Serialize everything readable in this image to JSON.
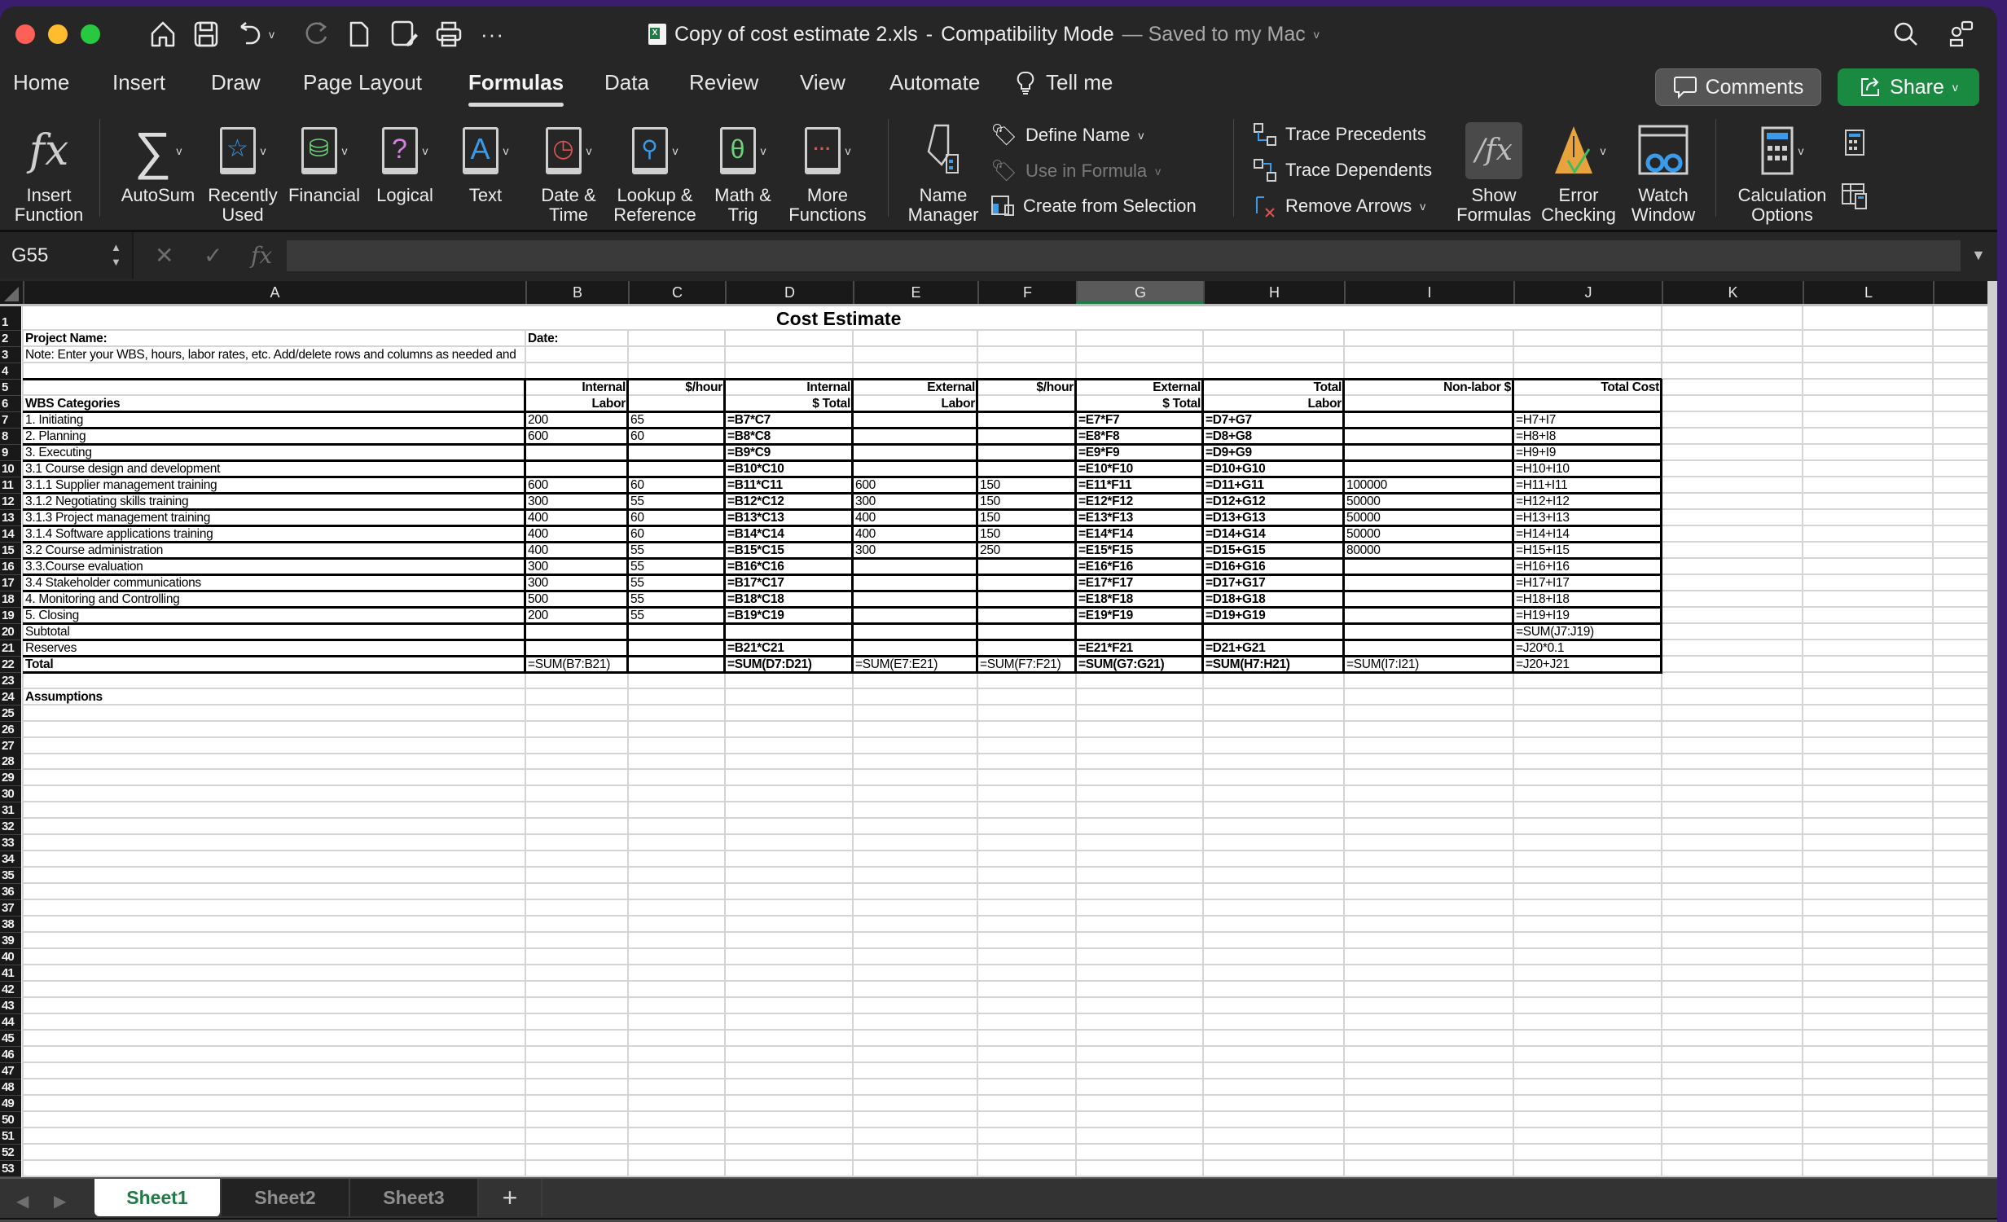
{
  "window": {
    "title": "Copy of cost estimate 2.xls",
    "mode": "Compatibility Mode",
    "save_status": "— Saved to my Mac"
  },
  "menu_tabs": [
    "Home",
    "Insert",
    "Draw",
    "Page Layout",
    "Formulas",
    "Data",
    "Review",
    "View",
    "Automate"
  ],
  "active_tab": "Formulas",
  "tell_me": "Tell me",
  "comments_label": "Comments",
  "share_label": "Share",
  "ribbon": {
    "insert_function": [
      "Insert",
      "Function"
    ],
    "autosum": "AutoSum",
    "recently_used": [
      "Recently",
      "Used"
    ],
    "financial": "Financial",
    "logical": "Logical",
    "text": "Text",
    "date_time": [
      "Date &",
      "Time"
    ],
    "lookup": [
      "Lookup &",
      "Reference"
    ],
    "math": [
      "Math &",
      "Trig"
    ],
    "more": [
      "More",
      "Functions"
    ],
    "name_manager": [
      "Name",
      "Manager"
    ],
    "define_name": "Define Name",
    "use_in_formula": "Use in Formula",
    "create_from_selection": "Create from Selection",
    "trace_precedents": "Trace Precedents",
    "trace_dependents": "Trace Dependents",
    "remove_arrows": "Remove Arrows",
    "show_formulas": [
      "Show",
      "Formulas"
    ],
    "error_checking": [
      "Error",
      "Checking"
    ],
    "watch_window": [
      "Watch",
      "Window"
    ],
    "calc_options": [
      "Calculation",
      "Options"
    ]
  },
  "formula_bar": {
    "name_box": "G55",
    "fx": "fx",
    "value": ""
  },
  "columns": [
    "A",
    "B",
    "C",
    "D",
    "E",
    "F",
    "G",
    "H",
    "I",
    "J",
    "K",
    "L"
  ],
  "selected_column": "G",
  "sheet": {
    "title": "Cost Estimate",
    "project_name_label": "Project Name:",
    "date_label": "Date:",
    "note": "Note: Enter your WBS, hours, labor rates, etc. Add/delete rows and columns as needed and",
    "headers_row5": {
      "B": "Internal",
      "C": "$/hour",
      "D": "Internal",
      "E": "External",
      "F": "$/hour",
      "G": "External",
      "H": "Total",
      "I": "Non-labor $",
      "J": "Total Cost"
    },
    "headers_row6": {
      "A": "WBS Categories",
      "B": "Labor",
      "D": "$ Total",
      "E": "Labor",
      "G": "$ Total",
      "H": "Labor"
    },
    "rows": [
      {
        "r": 7,
        "A": "1. Initiating",
        "B": "200",
        "C": "65",
        "D": "=B7*C7",
        "E": "",
        "F": "",
        "G": "=E7*F7",
        "H": "=D7+G7",
        "I": "",
        "J": "=H7+I7"
      },
      {
        "r": 8,
        "A": "2. Planning",
        "B": "600",
        "C": "60",
        "D": "=B8*C8",
        "E": "",
        "F": "",
        "G": "=E8*F8",
        "H": "=D8+G8",
        "I": "",
        "J": "=H8+I8"
      },
      {
        "r": 9,
        "A": "3. Executing",
        "B": "",
        "C": "",
        "D": "=B9*C9",
        "E": "",
        "F": "",
        "G": "=E9*F9",
        "H": "=D9+G9",
        "I": "",
        "J": "=H9+I9"
      },
      {
        "r": 10,
        "A": "  3.1 Course design and development",
        "B": "",
        "C": "",
        "D": "=B10*C10",
        "E": "",
        "F": "",
        "G": "=E10*F10",
        "H": "=D10+G10",
        "I": "",
        "J": "=H10+I10"
      },
      {
        "r": 11,
        "A": "      3.1.1 Supplier management training",
        "B": "600",
        "C": "60",
        "D": "=B11*C11",
        "E": "600",
        "F": "150",
        "G": "=E11*F11",
        "H": "=D11+G11",
        "I": "100000",
        "J": "=H11+I11"
      },
      {
        "r": 12,
        "A": "      3.1.2 Negotiating skills training",
        "B": "300",
        "C": "55",
        "D": "=B12*C12",
        "E": "300",
        "F": "150",
        "G": "=E12*F12",
        "H": "=D12+G12",
        "I": "50000",
        "J": "=H12+I12"
      },
      {
        "r": 13,
        "A": "      3.1.3  Project management training",
        "B": "400",
        "C": "60",
        "D": "=B13*C13",
        "E": "400",
        "F": "150",
        "G": "=E13*F13",
        "H": "=D13+G13",
        "I": "50000",
        "J": "=H13+I13"
      },
      {
        "r": 14,
        "A": "      3.1.4 Software applications training",
        "B": "400",
        "C": "60",
        "D": "=B14*C14",
        "E": "400",
        "F": "150",
        "G": "=E14*F14",
        "H": "=D14+G14",
        "I": "50000",
        "J": "=H14+I14"
      },
      {
        "r": 15,
        "A": "   3.2 Course administration",
        "B": "400",
        "C": "55",
        "D": "=B15*C15",
        "E": "300",
        "F": "250",
        "G": "=E15*F15",
        "H": "=D15+G15",
        "I": "80000",
        "J": "=H15+I15"
      },
      {
        "r": 16,
        "A": "   3.3.Course evaluation",
        "B": "300",
        "C": "55",
        "D": "=B16*C16",
        "E": "",
        "F": "",
        "G": "=E16*F16",
        "H": "=D16+G16",
        "I": "",
        "J": "=H16+I16"
      },
      {
        "r": 17,
        "A": "   3.4 Stakeholder communications",
        "B": "300",
        "C": "55",
        "D": "=B17*C17",
        "E": "",
        "F": "",
        "G": "=E17*F17",
        "H": "=D17+G17",
        "I": "",
        "J": "=H17+I17"
      },
      {
        "r": 18,
        "A": "4. Monitoring and Controlling",
        "B": "500",
        "C": "55",
        "D": "=B18*C18",
        "E": "",
        "F": "",
        "G": "=E18*F18",
        "H": "=D18+G18",
        "I": "",
        "J": "=H18+I18"
      },
      {
        "r": 19,
        "A": "5. Closing",
        "B": "200",
        "C": "55",
        "D": "=B19*C19",
        "E": "",
        "F": "",
        "G": "=E19*F19",
        "H": "=D19+G19",
        "I": "",
        "J": "=H19+I19"
      },
      {
        "r": 20,
        "A": "Subtotal",
        "B": "",
        "C": "",
        "D": "",
        "E": "",
        "F": "",
        "G": "",
        "H": "",
        "I": "",
        "J": "=SUM(J7:J19)"
      },
      {
        "r": 21,
        "A": "Reserves",
        "B": "",
        "C": "",
        "D": "=B21*C21",
        "E": "",
        "F": "",
        "G": "=E21*F21",
        "H": "=D21+G21",
        "I": "",
        "J": "=J20*0.1"
      },
      {
        "r": 22,
        "A": "Total",
        "B": "=SUM(B7:B21)",
        "C": "",
        "D": "=SUM(D7:D21)",
        "E": "=SUM(E7:E21)",
        "F": "=SUM(F7:F21)",
        "G": "=SUM(G7:G21)",
        "H": "=SUM(H7:H21)",
        "I": "=SUM(I7:I21)",
        "J": "=J20+J21"
      }
    ],
    "assumptions_label": "Assumptions"
  },
  "sheet_tabs": [
    "Sheet1",
    "Sheet2",
    "Sheet3"
  ],
  "active_sheet": "Sheet1",
  "add_sheet": "+"
}
